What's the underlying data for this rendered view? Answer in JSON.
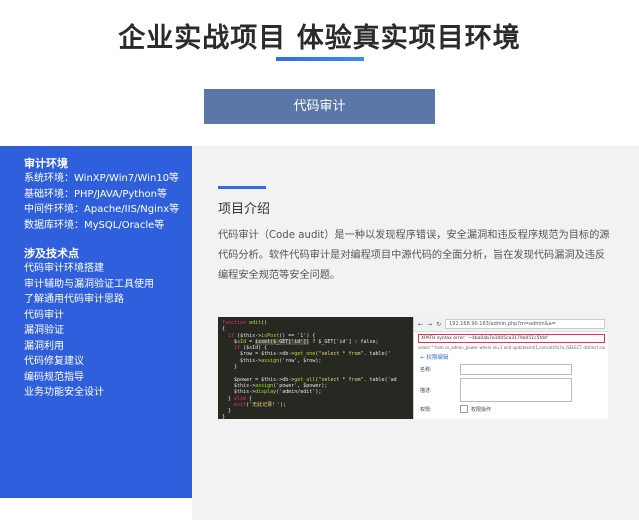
{
  "hero": {
    "title": "企业实战项目 体验真实项目环境"
  },
  "tab": {
    "label": "代码审计"
  },
  "sidebar": {
    "env_title": "审计环境",
    "env_items": [
      "系统环境：WinXP/Win7/Win10等",
      "基础环境：PHP/JAVA/Python等",
      "中间件环境：Apache/IIS/Nginx等",
      "数据库环境：MySQL/Oracle等"
    ],
    "tech_title": "涉及技术点",
    "tech_items": [
      "代码审计环境搭建",
      "审计辅助与漏洞验证工具使用",
      "了解通用代码审计思路",
      "代码审计",
      "漏洞验证",
      "漏洞利用",
      "代码修复建议",
      "编码规范指导",
      "业务功能安全设计"
    ]
  },
  "intro": {
    "title": "项目介绍",
    "text": "代码审计（Code audit）是一种以发现程序错误，安全漏洞和违反程序规范为目标的源代码分析。软件代码审计是对编程项目中源代码的全面分析，旨在发现代码漏洞及违反编程安全规范等安全问题。"
  },
  "screenshot": {
    "browser_url": "192.168.90.163/admin.php?m=admin&a=",
    "error_text": "XPATH syntax error: '~4ba0ab7a1005ca3179a051c5fdd'",
    "sql_text": "select * from ss_admin_power where id=1 and updatexml(1,concat(0x7e,(SELECT distinct concat(0x",
    "back_label": "← 权限编辑",
    "field1_label": "名称:",
    "field2_label": "描述:",
    "perm_label": "权限:",
    "perm_option": "权限操作"
  }
}
